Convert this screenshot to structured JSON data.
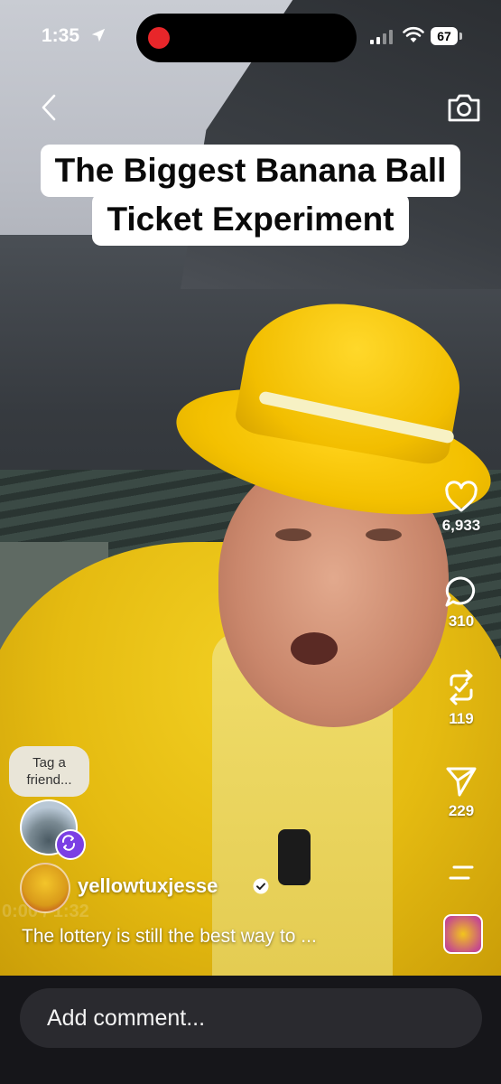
{
  "status_bar": {
    "time": "1:35",
    "battery": "67"
  },
  "video": {
    "title_line1": "The Biggest Banana Ball",
    "title_line2": "Ticket Experiment",
    "elapsed_ghost": "0:00 / 1:32"
  },
  "actions": {
    "likes": "6,933",
    "comments": "310",
    "reposts": "119",
    "shares": "229"
  },
  "tag_friend": {
    "label_line1": "Tag a",
    "label_line2": "friend..."
  },
  "author": {
    "username": "yellowtuxjesse",
    "caption": "The lottery is still the best way to ..."
  },
  "comment_bar": {
    "placeholder": "Add comment..."
  },
  "icons": {
    "back": "chevron-left-icon",
    "camera": "camera-icon",
    "like": "heart-icon",
    "comment": "comment-bubble-icon",
    "repost": "repost-icon",
    "share": "paper-plane-icon",
    "more": "menu-lines-icon",
    "verified": "verified-badge-icon"
  },
  "colors": {
    "record_dot": "#e8262a",
    "bottom_bar": "#16161a",
    "comment_field": "#2a2a2f",
    "repost_badge": "#7b3fe4"
  }
}
